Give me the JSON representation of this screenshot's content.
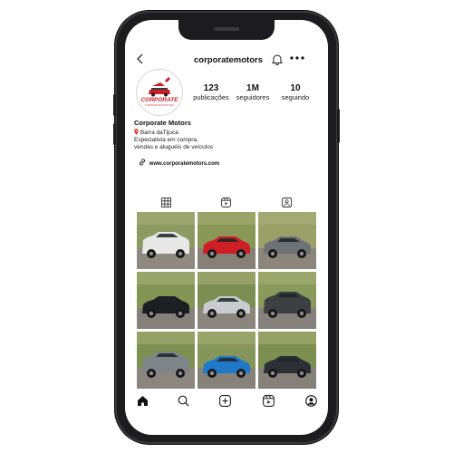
{
  "profile": {
    "username": "corporatemotors",
    "logo_text": "CORPORATE",
    "logo_subtext": "CORPORATE MOTORS",
    "stats": [
      {
        "value": "123",
        "label": "publicações"
      },
      {
        "value": "1M",
        "label": "seguidores"
      },
      {
        "value": "10",
        "label": "seguindo"
      }
    ],
    "name": "Corporate Motors",
    "location": "Barra daTijuca",
    "bio_line1": "Especialista em compra,",
    "bio_line2": "vendas e aluguéis de veículos",
    "website": "www.corporatemotors.com"
  },
  "colors": {
    "brand_red": "#c8202a",
    "frame": "#1c1c1e"
  },
  "icons": {
    "back": "chevron-left-icon",
    "notifications": "bell-icon",
    "more": "ellipsis-icon",
    "link": "link-icon",
    "location": "pin-icon",
    "tabs": [
      "grid-icon",
      "reels-icon",
      "tagged-icon"
    ],
    "bottom_nav": [
      "home-icon",
      "search-icon",
      "add-icon",
      "reels-icon",
      "profile-icon"
    ]
  },
  "posts": [
    {
      "subject": "white pickup truck",
      "car": "#e8e8e6",
      "bg": "#8f9a63",
      "ground": "#8e8a82"
    },
    {
      "subject": "red sports car",
      "car": "#cf1f26",
      "bg": "#8b9757",
      "ground": "#878078"
    },
    {
      "subject": "grey roadster",
      "car": "#6e7175",
      "bg": "#9aa068",
      "ground": "#8b857c"
    },
    {
      "subject": "black muscle car",
      "car": "#1d1e21",
      "bg": "#839455",
      "ground": "#858079"
    },
    {
      "subject": "silver sports car",
      "car": "#c9ccce",
      "bg": "#7d8e52",
      "ground": "#8a857d"
    },
    {
      "subject": "dark grey suv",
      "car": "#3d3f42",
      "bg": "#8a9a5c",
      "ground": "#86817a"
    },
    {
      "subject": "grey suv",
      "car": "#7f8489",
      "bg": "#7f8f52",
      "ground": "#8b867e"
    },
    {
      "subject": "blue sports car",
      "car": "#1f78c8",
      "bg": "#86965a",
      "ground": "#878279"
    },
    {
      "subject": "dark sedan",
      "car": "#2c3036",
      "bg": "#7e8e50",
      "ground": "#858078"
    }
  ]
}
